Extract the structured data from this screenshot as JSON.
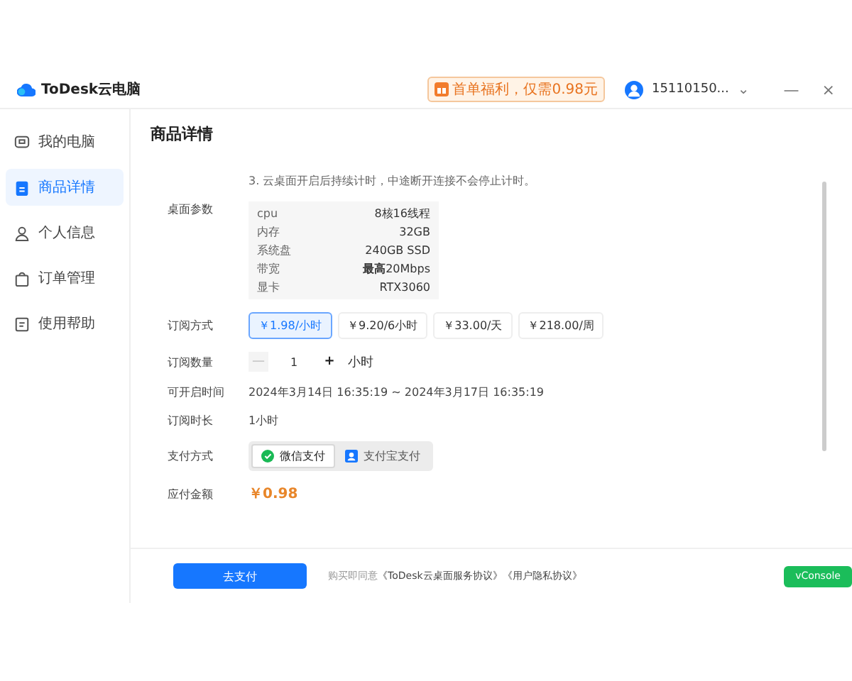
{
  "titlebar": {
    "app_name": "ToDesk云电脑",
    "promo": "首单福利，仅需0.98元",
    "user": "15110150...",
    "dropdown": "⌄",
    "minimize": "—",
    "close": "×"
  },
  "sidebar": {
    "items": [
      {
        "label": "我的电脑",
        "kind": "monitor",
        "selected": false
      },
      {
        "label": "商品详情",
        "kind": "clipboard",
        "selected": true
      },
      {
        "label": "个人信息",
        "kind": "person",
        "selected": false
      },
      {
        "label": "订单管理",
        "kind": "bag",
        "selected": false
      },
      {
        "label": "使用帮助",
        "kind": "doc",
        "selected": false
      }
    ]
  },
  "page_title": "商品详情",
  "note": "3. 云桌面开启后持续计时，中途断开连接不会停止计时。",
  "specs": {
    "label": "桌面参数",
    "rows": [
      {
        "name": "cpu",
        "value": "8核16线程"
      },
      {
        "name": "内存",
        "value": "32GB"
      },
      {
        "name": "系统盘",
        "value": "240GB SSD"
      },
      {
        "name": "带宽",
        "value": "**最高**20Mbps"
      },
      {
        "name": "显卡",
        "value": "RTX3060"
      }
    ]
  },
  "plans": {
    "label": "订阅方式",
    "options": [
      {
        "label": "￥1.98/小时",
        "selected": true
      },
      {
        "label": "￥9.20/6小时",
        "selected": false
      },
      {
        "label": "￥33.00/天",
        "selected": false
      },
      {
        "label": "￥218.00/周",
        "selected": false
      }
    ]
  },
  "quantity": {
    "label": "订阅数量",
    "minus": "—",
    "value": "1",
    "plus": "+",
    "unit": "小时",
    "minus_disabled": true
  },
  "time_range": {
    "label": "可开启时间",
    "value": "2024年3月14日 16:35:19 ~ 2024年3月17日 16:35:19"
  },
  "duration": {
    "label": "订阅时长",
    "value": "1小时"
  },
  "payment": {
    "label": "支付方式",
    "methods": [
      {
        "label": "微信支付",
        "kind": "wechat",
        "selected": true
      },
      {
        "label": "支付宝支付",
        "kind": "alipay",
        "selected": false
      }
    ]
  },
  "amount": {
    "label": "应付金额",
    "value": "￥0.98"
  },
  "footer": {
    "pay_button": "去支付",
    "agree_text": "购买即同意",
    "links": [
      "《ToDesk云桌面服务协议》",
      "《用户隐私协议》"
    ],
    "console_button": "vConsole"
  }
}
